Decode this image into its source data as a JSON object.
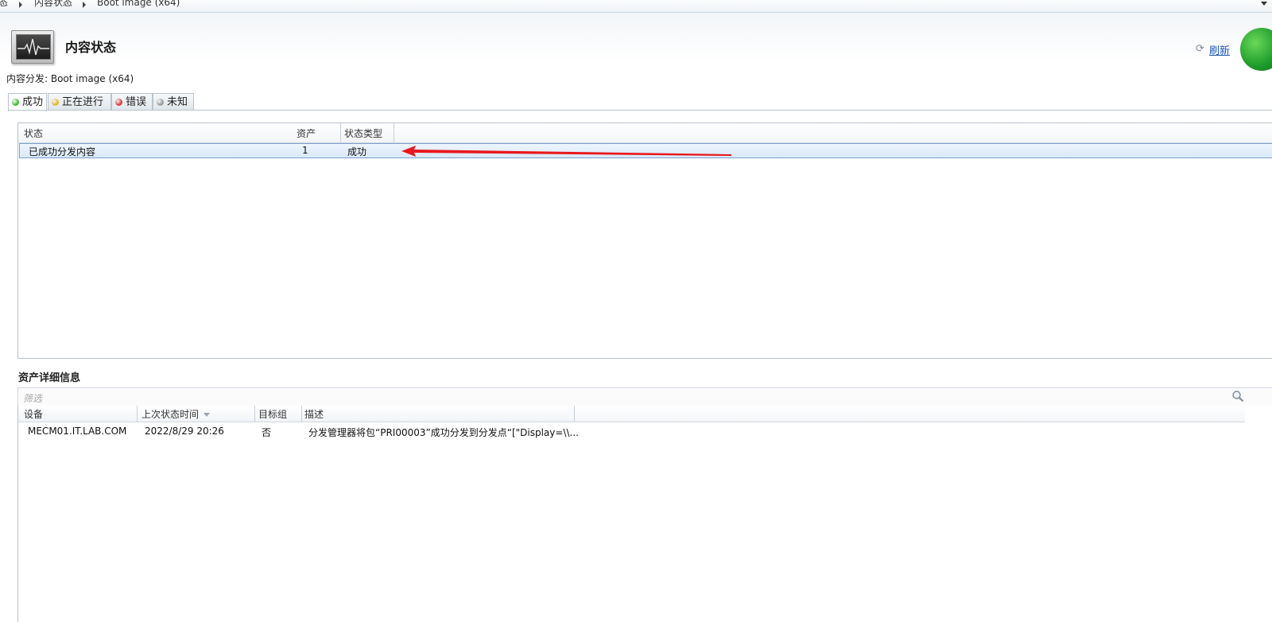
{
  "breadcrumb": {
    "items": [
      "态",
      "内容状态",
      "Boot image (x64)"
    ]
  },
  "header": {
    "title": "内容状态",
    "refresh_label": "刷新",
    "subtitle": "内容分发: Boot image (x64)"
  },
  "tabs": [
    {
      "label": "成功",
      "color": "#3cba2c"
    },
    {
      "label": "正在进行",
      "color": "#e3b82a"
    },
    {
      "label": "错误",
      "color": "#d93a3a"
    },
    {
      "label": "未知",
      "color": "#9a9a9a"
    }
  ],
  "status_table": {
    "columns": [
      "状态",
      "资产",
      "状态类型"
    ],
    "rows": [
      {
        "status": "已成功分发内容",
        "assets": "1",
        "type": "成功"
      }
    ]
  },
  "asset_details": {
    "title": "资产详细信息",
    "filter_placeholder": "筛选",
    "columns": [
      "设备",
      "上次状态时间",
      "目标组",
      "描述"
    ],
    "rows": [
      {
        "device": "MECM01.IT.LAB.COM",
        "last_status_time": "2022/8/29 20:26",
        "target_group": "否",
        "description": "分发管理器将包“PRI00003”成功分发到分发点“[\"Display=\\\\..."
      }
    ]
  },
  "annotation": {
    "arrow_color": "#e8181c"
  }
}
